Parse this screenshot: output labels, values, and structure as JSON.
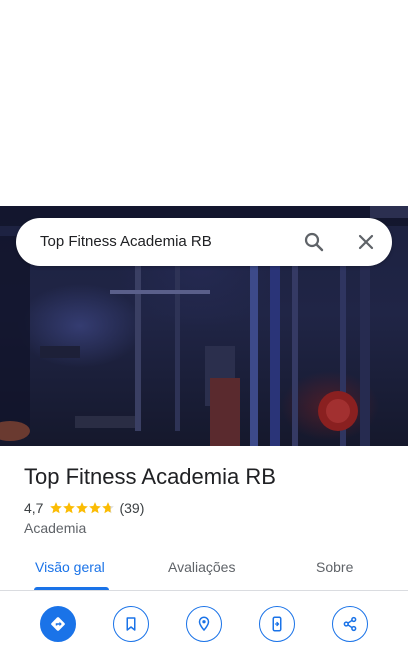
{
  "search": {
    "query": "Top Fitness Academia RB"
  },
  "icons": {
    "search": "search-icon",
    "close": "close-icon"
  },
  "place": {
    "title": "Top Fitness Academia RB",
    "rating": "4,7",
    "rating_value": 4.7,
    "reviews": "(39)",
    "category": "Academia"
  },
  "tabs": [
    {
      "label": "Visão geral",
      "active": true
    },
    {
      "label": "Avaliações",
      "active": false
    },
    {
      "label": "Sobre",
      "active": false
    }
  ],
  "actions": [
    {
      "icon": "directions-icon"
    },
    {
      "icon": "save-icon"
    },
    {
      "icon": "nearby-icon"
    },
    {
      "icon": "send-to-phone-icon"
    },
    {
      "icon": "share-icon"
    }
  ],
  "colors": {
    "accent": "#1a73e8",
    "star": "#fbbc04"
  }
}
